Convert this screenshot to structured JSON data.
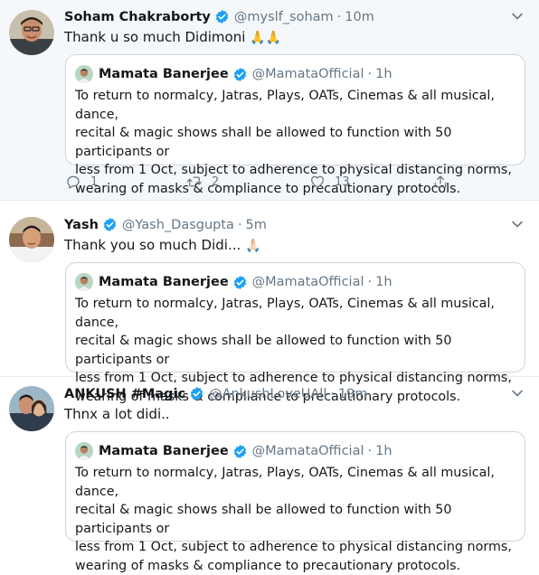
{
  "tweets": [
    {
      "name": "Soham Chakraborty",
      "handle": "@myslf_soham",
      "sep": "·",
      "time": "10m",
      "text": "Thank u so much Didimoni",
      "emoji": "🙏🙏",
      "quote": {
        "name": "Mamata Banerjee",
        "handle": "@MamataOfficial",
        "sep": "·",
        "time": "1h",
        "lines": [
          "To return to normalcy, Jatras, Plays, OATs, Cinemas & all musical, dance,",
          "recital & magic shows shall be allowed to function with 50 participants or",
          "less from 1 Oct, subject to adherence to physical distancing norms,",
          "wearing of masks & compliance to precautionary protocols."
        ]
      },
      "actions": {
        "replies": "1",
        "retweets": "2",
        "likes": "13"
      }
    },
    {
      "name": "Yash",
      "handle": "@Yash_Dasgupta",
      "sep": "·",
      "time": "5m",
      "text": "Thank you so much Didi...",
      "emoji": "🙏🏻",
      "quote": {
        "name": "Mamata Banerjee",
        "handle": "@MamataOfficial",
        "sep": "·",
        "time": "1h",
        "lines": [
          "To return to normalcy, Jatras, Plays, OATs, Cinemas & all musical, dance,",
          "recital & magic shows shall be allowed to function with 50 participants or",
          "less from 1 Oct, subject to adherence to physical distancing norms,",
          "wearing of masks & compliance to precautionary protocols."
        ]
      }
    },
    {
      "name": "ANKUSH #Magic",
      "handle": "@AnkushLoveUAll",
      "sep": "·",
      "time": "19m",
      "text": "Thnx a lot didi..",
      "quote": {
        "name": "Mamata Banerjee",
        "handle": "@MamataOfficial",
        "sep": "·",
        "time": "1h",
        "lines": [
          "To return to normalcy, Jatras, Plays, OATs, Cinemas & all musical, dance,",
          "recital & magic shows shall be allowed to function with 50 participants or",
          "less from 1 Oct, subject to adherence to physical distancing norms,",
          "wearing of masks & compliance to precautionary protocols."
        ]
      }
    }
  ],
  "icons": {
    "verified": "verified-badge-icon",
    "caret": "chevron-down-icon",
    "reply": "reply-icon",
    "retweet": "retweet-icon",
    "like": "heart-icon",
    "share": "share-icon"
  },
  "colors": {
    "verified": "#1da1f2",
    "muted": "#657786",
    "border": "#ccd6dd",
    "highlight_bg": "#f5f8fa"
  }
}
